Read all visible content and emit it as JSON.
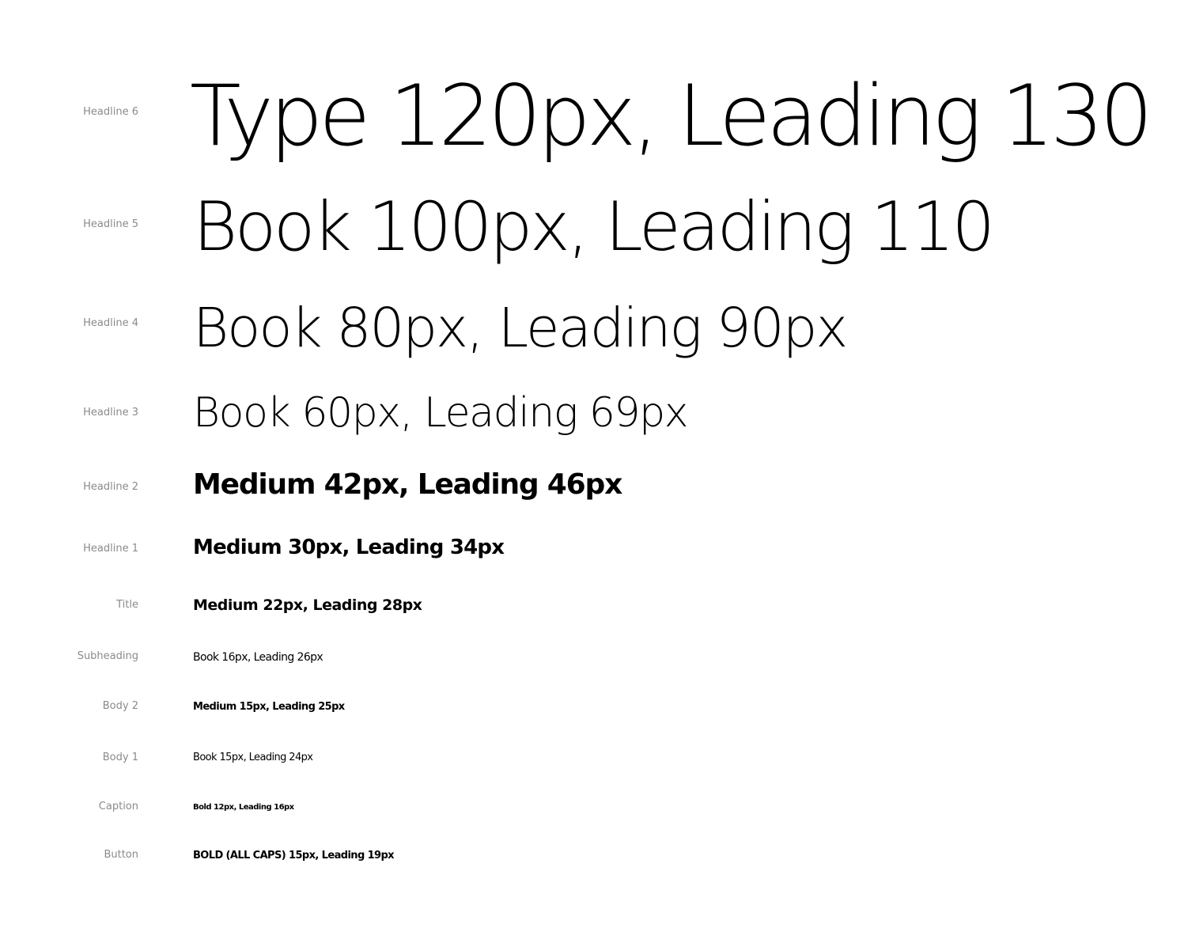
{
  "type_scale": [
    {
      "label": "Headline 6",
      "sample": "Type 120px, Leading 130"
    },
    {
      "label": "Headline 5",
      "sample": "Book 100px, Leading 110"
    },
    {
      "label": "Headline 4",
      "sample": "Book 80px, Leading 90px"
    },
    {
      "label": "Headline 3",
      "sample": "Book 60px, Leading 69px"
    },
    {
      "label": "Headline 2",
      "sample": "Medium 42px, Leading 46px"
    },
    {
      "label": "Headline 1",
      "sample": "Medium 30px, Leading 34px"
    },
    {
      "label": "Title",
      "sample": "Medium 22px, Leading 28px"
    },
    {
      "label": "Subheading",
      "sample": "Book 16px, Leading 26px"
    },
    {
      "label": "Body 2",
      "sample": "Medium 15px, Leading 25px"
    },
    {
      "label": "Body 1",
      "sample": "Book 15px, Leading 24px"
    },
    {
      "label": "Caption",
      "sample": "Bold 12px, Leading 16px"
    },
    {
      "label": "Button",
      "sample": "BOLD (ALL CAPS) 15px, Leading 19px"
    }
  ],
  "colors": {
    "label": "#8a8a8a",
    "sample": "#000000",
    "background": "#ffffff"
  }
}
